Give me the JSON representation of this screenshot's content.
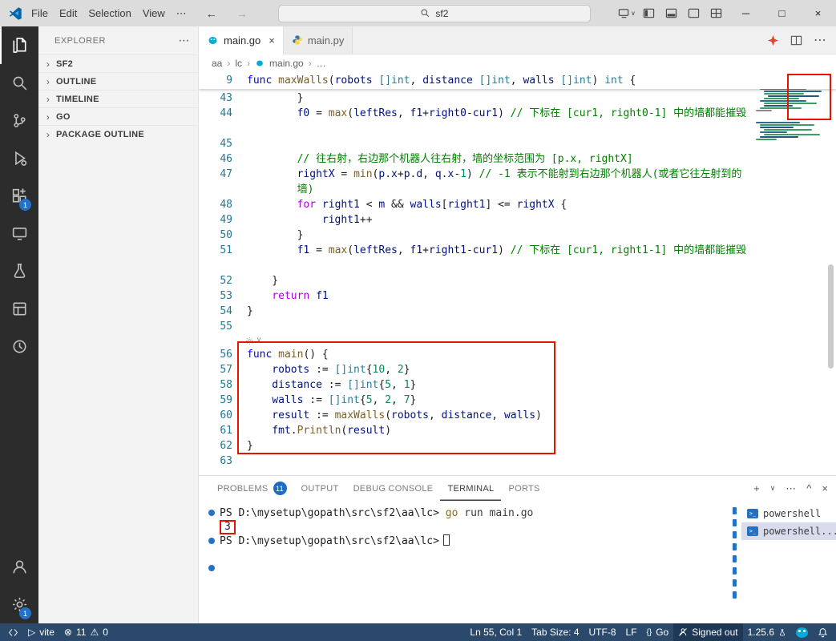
{
  "glyphs": {
    "back": "←",
    "forward": "→",
    "more": "…",
    "dots": "⋯",
    "chevron": "›",
    "chevron_down": "∨",
    "close": "×",
    "minimize": "─",
    "maximize": "□",
    "plus": "+",
    "caret": "^",
    "braces": "{}",
    "play": "▷",
    "error": "⊗",
    "warning": "⚠"
  },
  "title_bar": {
    "menus": [
      "File",
      "Edit",
      "Selection",
      "View"
    ],
    "menu_overflow": "⋯",
    "search": "sf2"
  },
  "activity_bar": {
    "extensions_badge": "1",
    "settings_badge": "1"
  },
  "sidebar": {
    "header": "EXPLORER",
    "sections": [
      {
        "label": "SF2"
      },
      {
        "label": "OUTLINE"
      },
      {
        "label": "TIMELINE"
      },
      {
        "label": "GO"
      },
      {
        "label": "PACKAGE OUTLINE"
      }
    ]
  },
  "tabs": [
    {
      "label": "main.go",
      "active": true
    },
    {
      "label": "main.py",
      "active": false
    }
  ],
  "breadcrumbs": [
    "aa",
    "lc",
    "main.go",
    "…"
  ],
  "editor": {
    "colors": {
      "kw": "#0000ff",
      "ctl": "#af00db",
      "fn": "#795e26",
      "ty": "#267f99",
      "n": "#098658",
      "c": "#008000",
      "v": "#001080",
      "op": "#1e1e1e"
    },
    "annotation_color": "#e51400",
    "sticky": {
      "n": "9",
      "t": [
        [
          "kw",
          "func "
        ],
        [
          "fn",
          "maxWalls"
        ],
        [
          "op",
          "("
        ],
        [
          "v",
          "robots "
        ],
        [
          "ty",
          "[]int"
        ],
        [
          "op",
          ", "
        ],
        [
          "v",
          "distance "
        ],
        [
          "ty",
          "[]int"
        ],
        [
          "op",
          ", "
        ],
        [
          "v",
          "walls "
        ],
        [
          "ty",
          "[]int"
        ],
        [
          "op",
          ") "
        ],
        [
          "ty",
          "int"
        ],
        [
          "op",
          " {"
        ]
      ]
    },
    "lines": [
      {
        "n": "43",
        "i": 8,
        "t": [
          [
            "op",
            "}"
          ]
        ]
      },
      {
        "n": "44",
        "i": 8,
        "w": 2,
        "t": [
          [
            "v",
            "f0"
          ],
          [
            "op",
            " = "
          ],
          [
            "fn",
            "max"
          ],
          [
            "op",
            "("
          ],
          [
            "v",
            "leftRes"
          ],
          [
            "op",
            ", "
          ],
          [
            "v",
            "f1"
          ],
          [
            "op",
            "+"
          ],
          [
            "v",
            "right0"
          ],
          [
            "op",
            "-"
          ],
          [
            "v",
            "cur1"
          ],
          [
            "op",
            ") "
          ],
          [
            "c",
            "// 下标在 [cur1, right0-1] 中的墙都能摧毁"
          ]
        ]
      },
      {
        "n": "45",
        "i": 0,
        "t": []
      },
      {
        "n": "46",
        "i": 8,
        "t": [
          [
            "c",
            "// 往右射，右边那个机器人往右射，墙的坐标范围为 [p.x, rightX]"
          ]
        ]
      },
      {
        "n": "47",
        "i": 8,
        "w": 2,
        "t": [
          [
            "v",
            "rightX"
          ],
          [
            "op",
            " = "
          ],
          [
            "fn",
            "min"
          ],
          [
            "op",
            "("
          ],
          [
            "v",
            "p"
          ],
          [
            "op",
            "."
          ],
          [
            "v",
            "x"
          ],
          [
            "op",
            "+"
          ],
          [
            "v",
            "p"
          ],
          [
            "op",
            "."
          ],
          [
            "v",
            "d"
          ],
          [
            "op",
            ", "
          ],
          [
            "v",
            "q"
          ],
          [
            "op",
            "."
          ],
          [
            "v",
            "x"
          ],
          [
            "op",
            "-"
          ],
          [
            "n",
            "1"
          ],
          [
            "op",
            ") "
          ],
          [
            "c",
            "// -1 表示不能射到右边那个机器人(或者它往左射到的墙)"
          ]
        ]
      },
      {
        "n": "48",
        "i": 8,
        "t": [
          [
            "ctl",
            "for"
          ],
          [
            "op",
            " "
          ],
          [
            "v",
            "right1"
          ],
          [
            "op",
            " < "
          ],
          [
            "v",
            "m"
          ],
          [
            "op",
            " && "
          ],
          [
            "v",
            "walls"
          ],
          [
            "op",
            "["
          ],
          [
            "v",
            "right1"
          ],
          [
            "op",
            "] <= "
          ],
          [
            "v",
            "rightX"
          ],
          [
            "op",
            " {"
          ]
        ]
      },
      {
        "n": "49",
        "i": 12,
        "t": [
          [
            "v",
            "right1"
          ],
          [
            "op",
            "++"
          ]
        ]
      },
      {
        "n": "50",
        "i": 8,
        "t": [
          [
            "op",
            "}"
          ]
        ]
      },
      {
        "n": "51",
        "i": 8,
        "w": 2,
        "t": [
          [
            "v",
            "f1"
          ],
          [
            "op",
            " = "
          ],
          [
            "fn",
            "max"
          ],
          [
            "op",
            "("
          ],
          [
            "v",
            "leftRes"
          ],
          [
            "op",
            ", "
          ],
          [
            "v",
            "f1"
          ],
          [
            "op",
            "+"
          ],
          [
            "v",
            "right1"
          ],
          [
            "op",
            "-"
          ],
          [
            "v",
            "cur1"
          ],
          [
            "op",
            ") "
          ],
          [
            "c",
            "// 下标在 [cur1, right1-1] 中的墙都能摧毁"
          ]
        ]
      },
      {
        "n": "52",
        "i": 4,
        "t": [
          [
            "op",
            "}"
          ]
        ]
      },
      {
        "n": "53",
        "i": 4,
        "t": [
          [
            "ctl",
            "return"
          ],
          [
            "op",
            " "
          ],
          [
            "v",
            "f1"
          ]
        ]
      },
      {
        "n": "54",
        "i": 0,
        "t": [
          [
            "op",
            "}"
          ]
        ]
      },
      {
        "n": "55",
        "i": 0,
        "t": []
      },
      {
        "lens": true
      },
      {
        "n": "56",
        "i": 0,
        "t": [
          [
            "kw",
            "func "
          ],
          [
            "fn",
            "main"
          ],
          [
            "op",
            "() {"
          ]
        ]
      },
      {
        "n": "57",
        "i": 4,
        "t": [
          [
            "v",
            "robots"
          ],
          [
            "op",
            " := "
          ],
          [
            "ty",
            "[]int"
          ],
          [
            "op",
            "{"
          ],
          [
            "n",
            "10"
          ],
          [
            "op",
            ", "
          ],
          [
            "n",
            "2"
          ],
          [
            "op",
            "}"
          ]
        ]
      },
      {
        "n": "58",
        "i": 4,
        "t": [
          [
            "v",
            "distance"
          ],
          [
            "op",
            " := "
          ],
          [
            "ty",
            "[]int"
          ],
          [
            "op",
            "{"
          ],
          [
            "n",
            "5"
          ],
          [
            "op",
            ", "
          ],
          [
            "n",
            "1"
          ],
          [
            "op",
            "}"
          ]
        ]
      },
      {
        "n": "59",
        "i": 4,
        "t": [
          [
            "v",
            "walls"
          ],
          [
            "op",
            " := "
          ],
          [
            "ty",
            "[]int"
          ],
          [
            "op",
            "{"
          ],
          [
            "n",
            "5"
          ],
          [
            "op",
            ", "
          ],
          [
            "n",
            "2"
          ],
          [
            "op",
            ", "
          ],
          [
            "n",
            "7"
          ],
          [
            "op",
            "}"
          ]
        ]
      },
      {
        "n": "60",
        "i": 4,
        "t": [
          [
            "v",
            "result"
          ],
          [
            "op",
            " := "
          ],
          [
            "fn",
            "maxWalls"
          ],
          [
            "op",
            "("
          ],
          [
            "v",
            "robots"
          ],
          [
            "op",
            ", "
          ],
          [
            "v",
            "distance"
          ],
          [
            "op",
            ", "
          ],
          [
            "v",
            "walls"
          ],
          [
            "op",
            ")"
          ]
        ]
      },
      {
        "n": "61",
        "i": 4,
        "t": [
          [
            "v",
            "fmt"
          ],
          [
            "op",
            "."
          ],
          [
            "fn",
            "Println"
          ],
          [
            "op",
            "("
          ],
          [
            "v",
            "result"
          ],
          [
            "op",
            ")"
          ]
        ]
      },
      {
        "n": "62",
        "i": 0,
        "t": [
          [
            "op",
            "}"
          ]
        ]
      },
      {
        "n": "63",
        "i": 0,
        "t": []
      }
    ]
  },
  "panel": {
    "tabs": [
      {
        "label": "PROBLEMS",
        "badge": "11"
      },
      {
        "label": "OUTPUT"
      },
      {
        "label": "DEBUG CONSOLE"
      },
      {
        "label": "TERMINAL",
        "active": true
      },
      {
        "label": "PORTS"
      }
    ],
    "terminal": {
      "lines": [
        {
          "dot": true,
          "prompt": "PS D:\\mysetup\\gopath\\src\\sf2\\aa\\lc>",
          "cmd": " go",
          "args": " run main.go"
        },
        {
          "out": "3",
          "boxed": true
        },
        {
          "dot": true,
          "prompt": "PS D:\\mysetup\\gopath\\src\\sf2\\aa\\lc>",
          "cursor": true
        },
        {
          "blank": true
        },
        {
          "dot": true
        }
      ],
      "list": [
        {
          "label": "powershell"
        },
        {
          "label": "powershell...",
          "selected": true
        }
      ]
    }
  },
  "status_bar": {
    "task": "vite",
    "errors": "11",
    "warnings": "0",
    "cursor": "Ln 55, Col 1",
    "tab_size": "Tab Size: 4",
    "encoding": "UTF-8",
    "eol": "LF",
    "language": "Go",
    "signed": "Signed out",
    "go_version": "1.25.6"
  }
}
